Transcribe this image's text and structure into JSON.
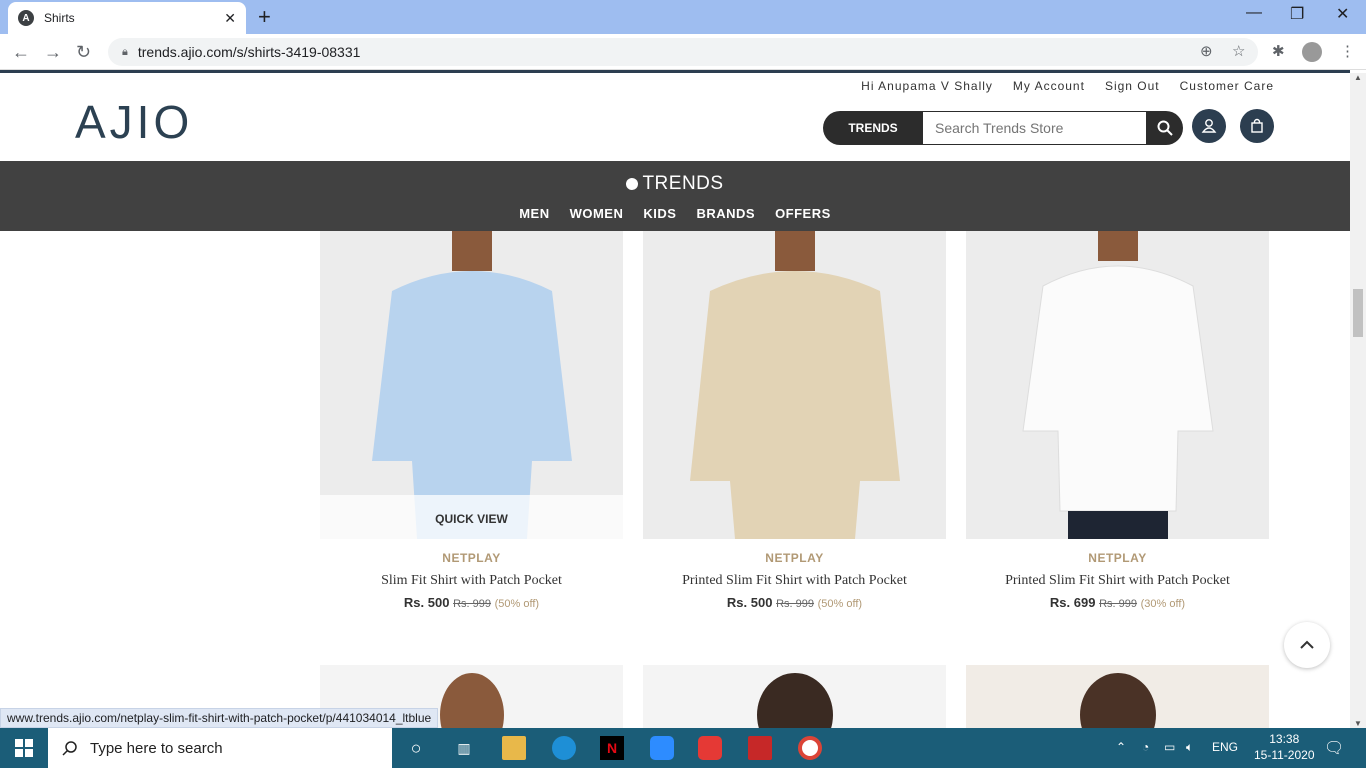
{
  "browser": {
    "tab_title": "Shirts",
    "tab_favicon": "A",
    "url": "trends.ajio.com/s/shirts-3419-08331",
    "status_url": "www.trends.ajio.com/netplay-slim-fit-shirt-with-patch-pocket/p/441034014_ltblue"
  },
  "header": {
    "logo": "AJIO",
    "links": [
      "Hi Anupama V Shally",
      "My Account",
      "Sign Out",
      "Customer Care"
    ],
    "store_label": "TRENDS",
    "search_placeholder": "Search Trends Store"
  },
  "trends_bar": {
    "logo": "TRENDS",
    "nav": [
      "MEN",
      "WOMEN",
      "KIDS",
      "BRANDS",
      "OFFERS"
    ]
  },
  "products": [
    {
      "brand": "NETPLAY",
      "name": "Slim Fit Shirt with Patch Pocket",
      "price": "Rs. 500",
      "mrp": "Rs. 999",
      "discount": "(50% off)",
      "quick_view": "QUICK VIEW",
      "shirt_color": "#b8d3ee"
    },
    {
      "brand": "NETPLAY",
      "name": "Printed Slim Fit Shirt with Patch Pocket",
      "price": "Rs. 500",
      "mrp": "Rs. 999",
      "discount": "(50% off)",
      "quick_view": "",
      "shirt_color": "#e2d3b5"
    },
    {
      "brand": "NETPLAY",
      "name": "Printed Slim Fit Shirt with Patch Pocket",
      "price": "Rs. 699",
      "mrp": "Rs. 999",
      "discount": "(30% off)",
      "quick_view": "",
      "shirt_color": "#fbfbfb"
    }
  ],
  "taskbar": {
    "search_text": "Type here to search",
    "lang": "ENG",
    "time": "13:38",
    "date": "15-11-2020"
  }
}
